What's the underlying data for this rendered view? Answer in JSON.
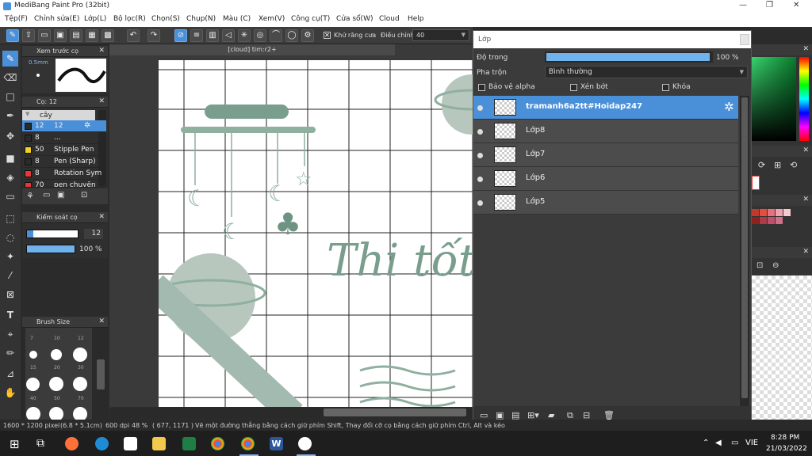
{
  "app": {
    "title": "MediBang Paint Pro (32bit)"
  },
  "menu": [
    "Tệp(F)",
    "Chỉnh sửa(E)",
    "Lớp(L)",
    "Bộ lọc(R)",
    "Chọn(S)",
    "Chụp(N)",
    "Màu (C)",
    "Xem(V)",
    "Công cụ(T)",
    "Cửa sổ(W)",
    "Cloud",
    "Help"
  ],
  "toolbar": {
    "antialias_label": "Khử răng cưa",
    "adjust_label": "Điều chỉnh",
    "adjust_value": "40"
  },
  "document": {
    "tab_title": "[cloud] tim:r2+",
    "art_text": "Thi tốt"
  },
  "preview_panel": {
    "title": "Xem trước cọ",
    "size": "0.5mm"
  },
  "brush_panel": {
    "title": "Cọ: 12",
    "group": "cây",
    "items": [
      {
        "size": "12",
        "name": "12",
        "color": "#2a2a2a"
      },
      {
        "size": "8",
        "name": "...",
        "color": "#2a2a2a"
      },
      {
        "size": "50",
        "name": "Stipple Pen",
        "color": "#f2d21a"
      },
      {
        "size": "8",
        "name": "Pen (Sharp)",
        "color": "#2a2a2a"
      },
      {
        "size": "8",
        "name": "Rotation Sym",
        "color": "#e53935"
      },
      {
        "size": "70",
        "name": "pen chuyên",
        "color": "#e53935"
      }
    ]
  },
  "control_panel": {
    "title": "Kiểm soát cọ",
    "size_value": "12",
    "opacity_value": "100 %",
    "size_fraction": 0.12,
    "opacity_fraction": 1.0
  },
  "brushsize_panel": {
    "title": "Brush Size",
    "labels": [
      "7",
      "10",
      "12",
      "15",
      "20",
      "30",
      "40",
      "50",
      "70"
    ]
  },
  "layer_panel": {
    "title": "Lớp",
    "opacity_label": "Độ trong",
    "opacity_value": "100 %",
    "blend_label": "Pha trộn",
    "blend_value": "Bình thường",
    "protect_alpha": "Bảo vệ alpha",
    "clipping": "Xén bớt",
    "lock": "Khóa",
    "layers": [
      {
        "name": "tramanh6a2tt#Hoidap247",
        "selected": true
      },
      {
        "name": "Lớp8",
        "selected": false
      },
      {
        "name": "Lớp7",
        "selected": false
      },
      {
        "name": "Lớp6",
        "selected": false
      },
      {
        "name": "Lớp5",
        "selected": false
      }
    ]
  },
  "status": {
    "size": "1600 * 1200 pixel",
    "cm": "(6.8 * 5.1cm)",
    "dpi": "600 dpi",
    "zoom": "48 %",
    "coords": "( 677, 1171 )",
    "hint": "Vẽ một đường thẳng bằng cách giữ phím Shift, Thay đổi cỡ cọ bằng cách giữ phím Ctrl, Alt và kéo"
  },
  "taskbar": {
    "lang": "VIE",
    "time": "8:28 PM",
    "date": "21/03/2022"
  },
  "colors": {
    "accent": "#4a90d9",
    "art": "#7a9e8e",
    "planet": "#b7c7bd"
  }
}
